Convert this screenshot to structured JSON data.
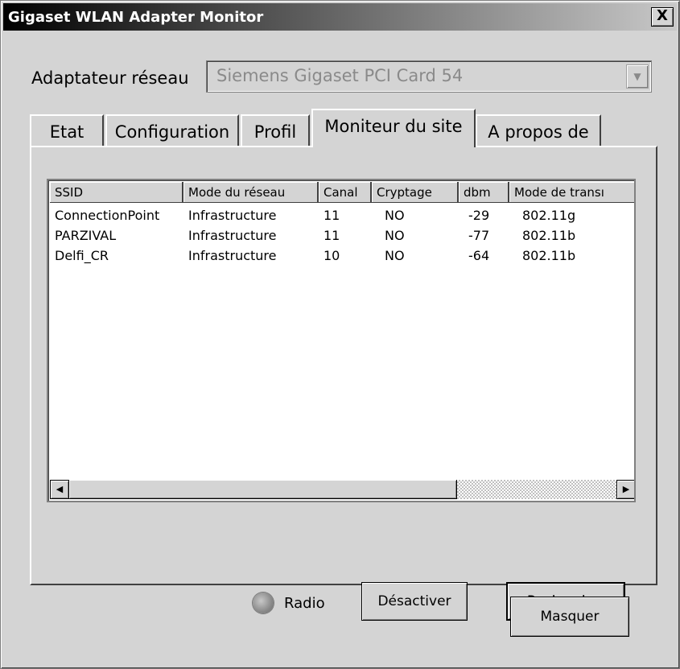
{
  "window": {
    "title": "Gigaset WLAN Adapter Monitor",
    "close_label": "X"
  },
  "adapter": {
    "label": "Adaptateur réseau",
    "value": "Siemens Gigaset PCI Card 54",
    "arrow": "▼"
  },
  "tabs": [
    {
      "label": "Etat"
    },
    {
      "label": "Configuration"
    },
    {
      "label": "Profil"
    },
    {
      "label": "Moniteur du site",
      "active": true
    },
    {
      "label": "A propos de"
    }
  ],
  "networks": {
    "columns": [
      "SSID",
      "Mode du réseau",
      "Canal",
      "Cryptage",
      "dbm",
      "Mode de transı"
    ],
    "rows": [
      [
        "ConnectionPoint",
        "Infrastructure",
        "11",
        "NO",
        "-29",
        "802.11g"
      ],
      [
        "PARZIVAL",
        "Infrastructure",
        "11",
        "NO",
        "-77",
        "802.11b"
      ],
      [
        "Delfi_CR",
        "Infrastructure",
        "10",
        "NO",
        "-64",
        "802.11b"
      ]
    ]
  },
  "scrollbar": {
    "left_arrow": "◀",
    "right_arrow": "▶"
  },
  "controls": {
    "radio_label": "Radio",
    "disable_label": "Désactiver",
    "search_label": "Rechercher",
    "hide_label": "Masquer"
  }
}
